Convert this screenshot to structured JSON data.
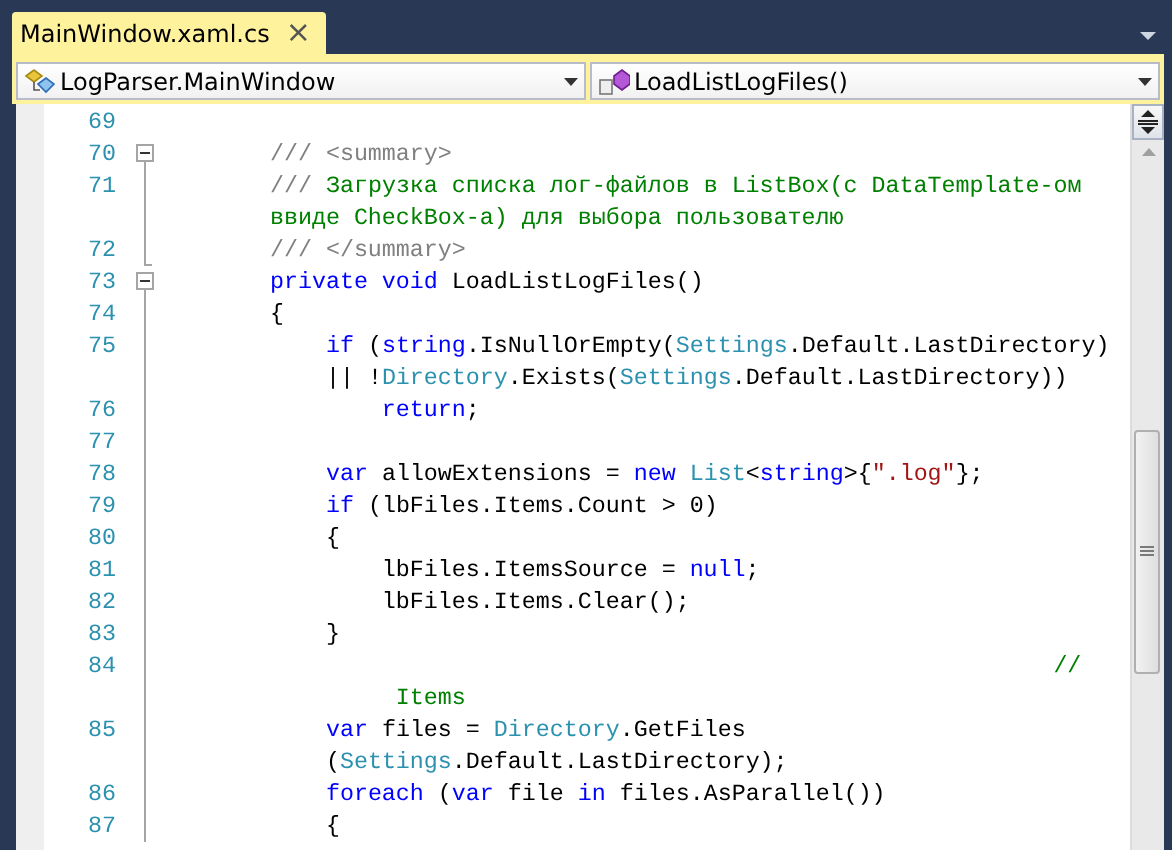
{
  "tab": {
    "title": "MainWindow.xaml.cs",
    "close": "×",
    "selected": true
  },
  "nav": {
    "type_selector": "LogParser.MainWindow",
    "member_selector": "LoadListLogFiles()"
  },
  "rows": [
    {
      "number": "69",
      "kind": "plain",
      "tokens": []
    },
    {
      "number": "70",
      "kind": "fold-start",
      "indent": "        ",
      "tokens": [
        {
          "kind": "doc",
          "text": "/// <summary>"
        }
      ]
    },
    {
      "number": "71",
      "kind": "fold-inside",
      "indent": "        ",
      "tokens": [
        {
          "kind": "doc",
          "text": "///"
        },
        {
          "kind": "comment",
          "text": " Загрузка списка лог-файлов в ListBox(с DataTemplate-ом"
        }
      ]
    },
    {
      "kind": "fold-inside",
      "indent": "        ",
      "tokens": [
        {
          "kind": "comment",
          "text": "ввиде CheckBox-а) для выбора пользователю"
        }
      ]
    },
    {
      "number": "72",
      "kind": "fold-end",
      "indent": "        ",
      "tokens": [
        {
          "kind": "doc",
          "text": "/// </summary>"
        }
      ]
    },
    {
      "number": "73",
      "kind": "fold-start",
      "indent": "        ",
      "tokens": [
        {
          "kind": "keyword",
          "text": "private"
        },
        {
          "kind": "keyword",
          "text": " void"
        },
        {
          "kind": "plain",
          "text": " LoadListLogFiles()"
        }
      ]
    },
    {
      "number": "74",
      "kind": "fold-inside",
      "indent": "        ",
      "tokens": [
        {
          "kind": "plain",
          "text": "{"
        }
      ]
    },
    {
      "number": "75",
      "kind": "fold-inside",
      "indent": "            ",
      "tokens": [
        {
          "kind": "keyword",
          "text": "if"
        },
        {
          "kind": "plain",
          "text": " ("
        },
        {
          "kind": "keyword",
          "text": "string"
        },
        {
          "kind": "plain",
          "text": ".IsNullOrEmpty("
        },
        {
          "kind": "type",
          "text": "Settings"
        },
        {
          "kind": "plain",
          "text": ".Default.LastDirectory)"
        }
      ]
    },
    {
      "kind": "fold-inside",
      "indent": "            ",
      "tokens": [
        {
          "kind": "plain",
          "text": "|| !"
        },
        {
          "kind": "type",
          "text": "Directory"
        },
        {
          "kind": "plain",
          "text": ".Exists("
        },
        {
          "kind": "type",
          "text": "Settings"
        },
        {
          "kind": "plain",
          "text": ".Default.LastDirectory))"
        }
      ]
    },
    {
      "number": "76",
      "kind": "fold-inside",
      "indent": "                ",
      "tokens": [
        {
          "kind": "keyword",
          "text": "return"
        },
        {
          "kind": "plain",
          "text": ";"
        }
      ]
    },
    {
      "number": "77",
      "kind": "fold-inside",
      "tokens": []
    },
    {
      "number": "78",
      "kind": "fold-inside",
      "indent": "            ",
      "tokens": [
        {
          "kind": "keyword",
          "text": "var"
        },
        {
          "kind": "plain",
          "text": " allowExtensions = "
        },
        {
          "kind": "keyword",
          "text": "new"
        },
        {
          "kind": "type",
          "text": " List"
        },
        {
          "kind": "plain",
          "text": "<"
        },
        {
          "kind": "keyword",
          "text": "string"
        },
        {
          "kind": "plain",
          "text": ">{"
        },
        {
          "kind": "string",
          "text": "\".log\""
        },
        {
          "kind": "plain",
          "text": "};"
        }
      ]
    },
    {
      "number": "79",
      "kind": "fold-inside",
      "indent": "            ",
      "tokens": [
        {
          "kind": "keyword",
          "text": "if"
        },
        {
          "kind": "plain",
          "text": " (lbFiles.Items.Count > 0)"
        }
      ]
    },
    {
      "number": "80",
      "kind": "fold-inside",
      "indent": "            ",
      "tokens": [
        {
          "kind": "plain",
          "text": "{"
        }
      ]
    },
    {
      "number": "81",
      "kind": "fold-inside",
      "indent": "                ",
      "tokens": [
        {
          "kind": "plain",
          "text": "lbFiles.ItemsSource = "
        },
        {
          "kind": "keyword",
          "text": "null"
        },
        {
          "kind": "plain",
          "text": ";"
        }
      ]
    },
    {
      "number": "82",
      "kind": "fold-inside",
      "indent": "                ",
      "tokens": [
        {
          "kind": "plain",
          "text": "lbFiles.Items.Clear();"
        }
      ]
    },
    {
      "number": "83",
      "kind": "fold-inside",
      "indent": "            ",
      "tokens": [
        {
          "kind": "plain",
          "text": "}"
        }
      ]
    },
    {
      "number": "84",
      "kind": "fold-inside",
      "indent": "                                                                ",
      "tokens": [
        {
          "kind": "comment",
          "text": "//"
        }
      ]
    },
    {
      "kind": "fold-inside",
      "indent": "                 ",
      "tokens": [
        {
          "kind": "comment",
          "text": "Items"
        }
      ]
    },
    {
      "number": "85",
      "kind": "fold-inside",
      "indent": "            ",
      "tokens": [
        {
          "kind": "keyword",
          "text": "var"
        },
        {
          "kind": "plain",
          "text": " files = "
        },
        {
          "kind": "type",
          "text": "Directory"
        },
        {
          "kind": "plain",
          "text": ".GetFiles"
        }
      ]
    },
    {
      "kind": "fold-inside",
      "indent": "            ",
      "tokens": [
        {
          "kind": "plain",
          "text": "("
        },
        {
          "kind": "type",
          "text": "Settings"
        },
        {
          "kind": "plain",
          "text": ".Default.LastDirectory);"
        }
      ]
    },
    {
      "number": "86",
      "kind": "fold-inside",
      "indent": "            ",
      "tokens": [
        {
          "kind": "keyword",
          "text": "foreach"
        },
        {
          "kind": "plain",
          "text": " ("
        },
        {
          "kind": "keyword",
          "text": "var"
        },
        {
          "kind": "plain",
          "text": " file "
        },
        {
          "kind": "keyword",
          "text": "in"
        },
        {
          "kind": "plain",
          "text": " files.AsParallel())"
        }
      ]
    },
    {
      "number": "87",
      "kind": "fold-inside",
      "indent": "            ",
      "tokens": [
        {
          "kind": "plain",
          "text": "{"
        }
      ]
    }
  ]
}
